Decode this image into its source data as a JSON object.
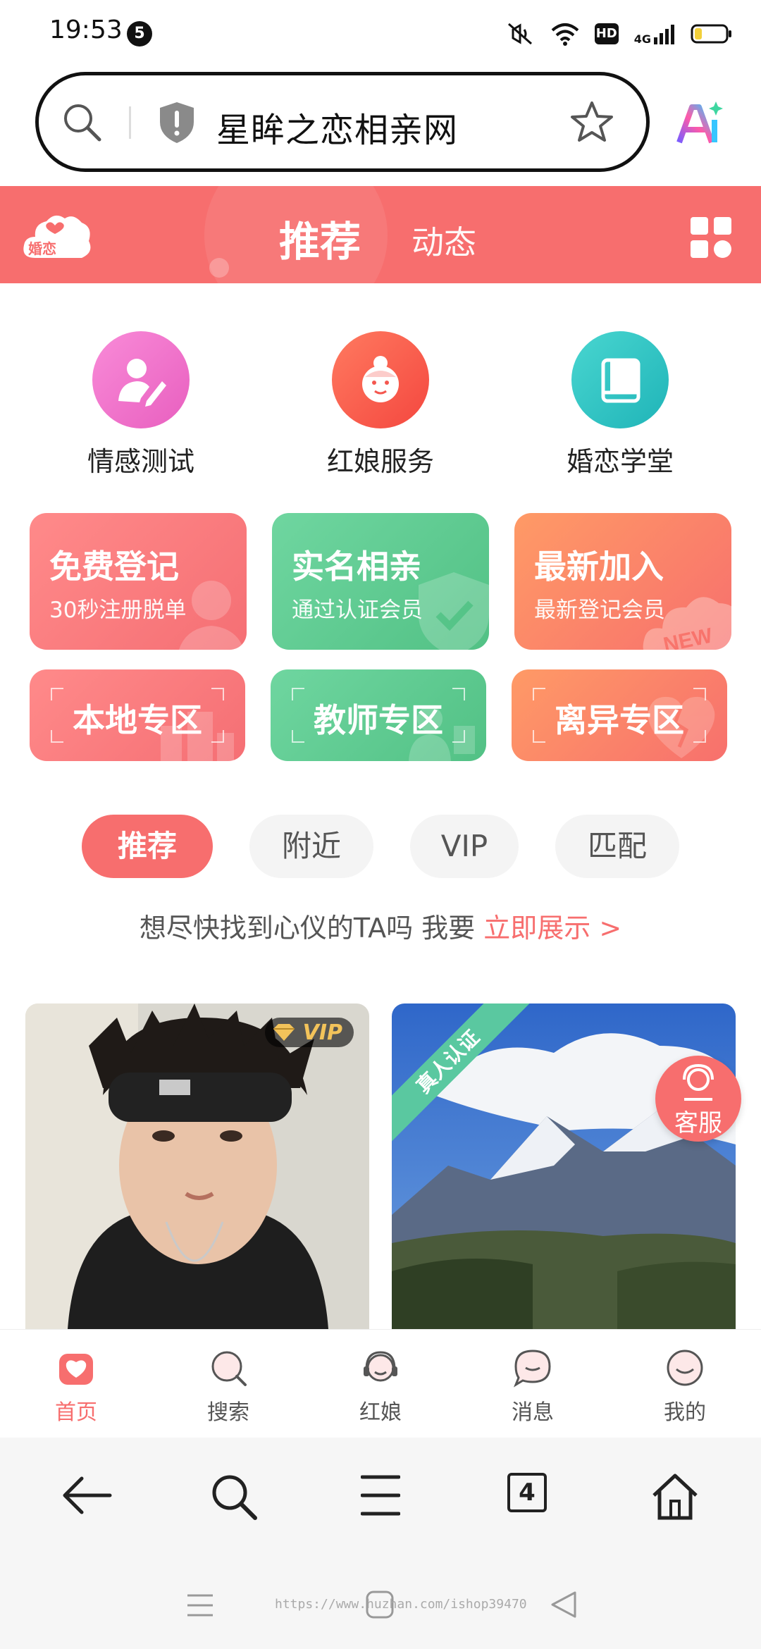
{
  "status_bar": {
    "time": "19:53",
    "notification_count": "5",
    "hd": "HD",
    "network": "4G"
  },
  "address_bar": {
    "url_text": "星眸之恋相亲网"
  },
  "app_header": {
    "logo_text": "婚恋",
    "tabs": [
      {
        "label": "推荐",
        "active": true
      },
      {
        "label": "动态",
        "active": false
      }
    ]
  },
  "services": [
    {
      "label": "情感测试",
      "icon": "person-pen-icon",
      "color": "#f06fc6"
    },
    {
      "label": "红娘服务",
      "icon": "matchmaker-face-icon",
      "color": "#f4574f"
    },
    {
      "label": "婚恋学堂",
      "icon": "book-icon",
      "color": "#2cc3c3"
    }
  ],
  "feature_cards": [
    {
      "title": "免费登记",
      "subtitle": "30秒注册脱单",
      "color": "#f77a7a"
    },
    {
      "title": "实名相亲",
      "subtitle": "通过认证会员",
      "color": "#5fcb92"
    },
    {
      "title": "最新加入",
      "subtitle": "最新登记会员",
      "color": "#f98063",
      "badge": "NEW"
    }
  ],
  "zone_cards": [
    {
      "title": "本地专区",
      "color": "#f77a7a"
    },
    {
      "title": "教师专区",
      "color": "#5fcb92"
    },
    {
      "title": "离异专区",
      "color": "#f98063"
    }
  ],
  "filters": [
    {
      "label": "推荐",
      "active": true
    },
    {
      "label": "附近",
      "active": false
    },
    {
      "label": "VIP",
      "active": false
    },
    {
      "label": "匹配",
      "active": false
    }
  ],
  "promo": {
    "text": "想尽快找到心仪的TA吗 我要 ",
    "link": "立即展示 >"
  },
  "profiles": [
    {
      "badge": "VIP",
      "image": "young-man-headband-photo"
    },
    {
      "badge": "真人认证",
      "image": "snow-mountain-photo"
    }
  ],
  "customer_service": {
    "label": "客服"
  },
  "app_nav": [
    {
      "label": "首页",
      "icon": "home-heart-icon",
      "active": true
    },
    {
      "label": "搜索",
      "icon": "search-icon",
      "active": false
    },
    {
      "label": "红娘",
      "icon": "headset-icon",
      "active": false
    },
    {
      "label": "消息",
      "icon": "message-icon",
      "active": false
    },
    {
      "label": "我的",
      "icon": "profile-icon",
      "active": false
    }
  ],
  "browser_toolbar": {
    "tab_count": "4"
  },
  "watermark": "https://www.huzhan.com/ishop39470",
  "colors": {
    "brand": "#f76e6e",
    "green": "#5fcb92",
    "orange": "#f98063"
  }
}
